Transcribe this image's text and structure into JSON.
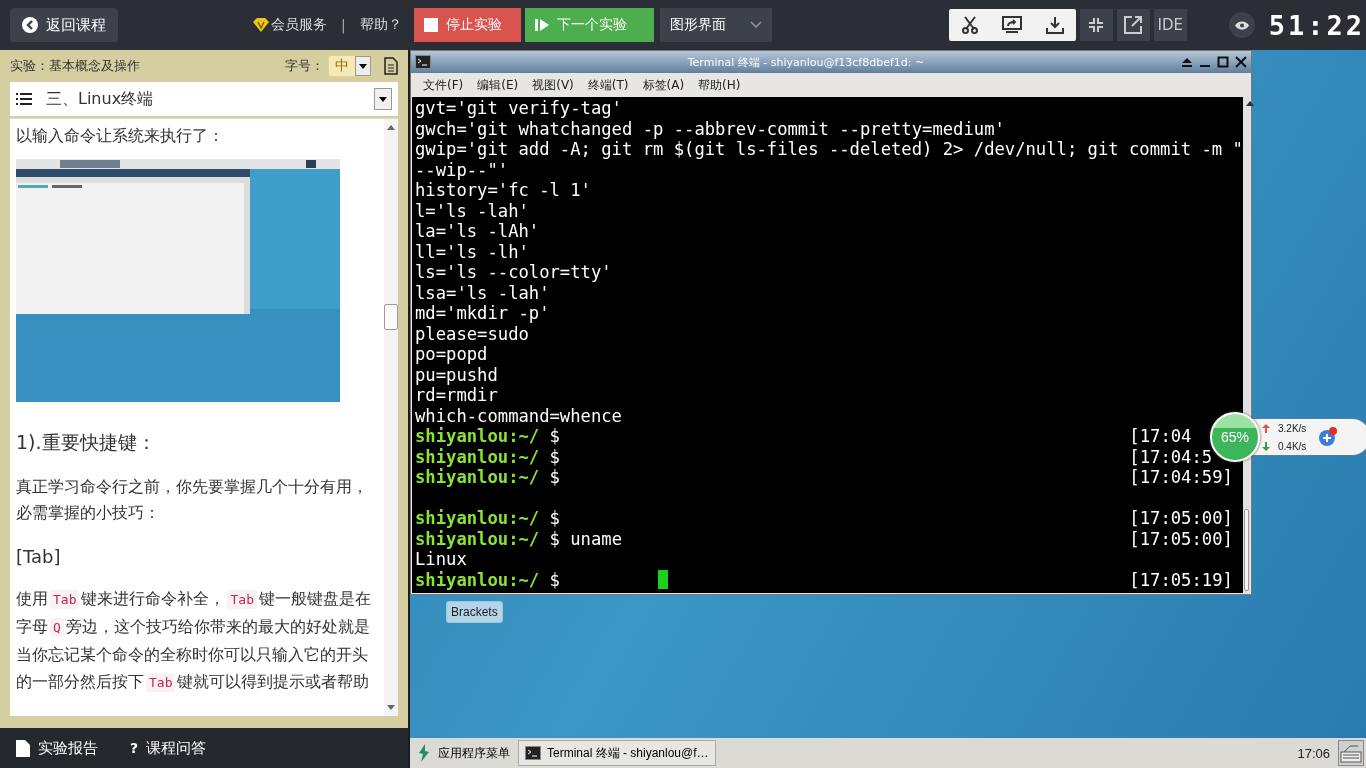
{
  "topbar": {
    "back_button": "返回课程",
    "vip_link": "会员服务",
    "separator": "|",
    "help_link": "帮助？",
    "stop_button": "停止实验",
    "next_button": "下一个实验",
    "mode_dropdown": "图形界面",
    "ide_button": "IDE",
    "timer": "51:22"
  },
  "lab_panel": {
    "lab_title": "实验：基本概念及操作",
    "font_size_label": "字号：",
    "font_size_value": "中",
    "section_select": "三、Linux终端",
    "content": [
      {
        "kind": "paragraph",
        "text": "以输入命令让系统来执行了："
      },
      {
        "kind": "picture"
      },
      {
        "kind": "heading",
        "text": "1).重要快捷键："
      },
      {
        "kind": "paragraph",
        "text": "真正学习命令行之前，你先要掌握几个十分有用，必需掌握的小技巧："
      },
      {
        "kind": "subheading",
        "text": "[Tab]"
      },
      {
        "kind": "code_paragraph",
        "segments": [
          {
            "kind": "text",
            "text": "使用"
          },
          {
            "kind": "code",
            "text": "Tab"
          },
          {
            "kind": "text",
            "text": "键来进行命令补全，"
          },
          {
            "kind": "code",
            "text": "Tab"
          },
          {
            "kind": "text",
            "text": "键一般键盘是在字母"
          },
          {
            "kind": "code",
            "text": "Q"
          },
          {
            "kind": "text",
            "text": "旁边，这个技巧给你带来的最大的好处就是当你忘记某个命令的全称时你可以只输入它的开头的一部分然后按下"
          },
          {
            "kind": "code",
            "text": "Tab"
          },
          {
            "kind": "text",
            "text": "键就可以得到提示或者帮助"
          }
        ]
      }
    ]
  },
  "footer": [
    {
      "kind": "report",
      "label": "实验报告"
    },
    {
      "kind": "qa",
      "icon": "?",
      "label": "课程问答"
    }
  ],
  "terminal": {
    "title": "Terminal 终端 - shiyanlou@f13cf8dbef1d: ~",
    "menu": [
      "文件(F)",
      "编辑(E)",
      "视图(V)",
      "终端(T)",
      "标签(A)",
      "帮助(H)"
    ],
    "lines": [
      {
        "kind": "output",
        "text": "gvt='git verify-tag'"
      },
      {
        "kind": "output",
        "text": "gwch='git whatchanged -p --abbrev-commit --pretty=medium'"
      },
      {
        "kind": "output",
        "text": "gwip='git add -A; git rm $(git ls-files --deleted) 2> /dev/null; git commit -m \""
      },
      {
        "kind": "output",
        "text": "--wip--\"'"
      },
      {
        "kind": "output",
        "text": "history='fc -l 1'"
      },
      {
        "kind": "output",
        "text": "l='ls -lah'"
      },
      {
        "kind": "output",
        "text": "la='ls -lAh'"
      },
      {
        "kind": "output",
        "text": "ll='ls -lh'"
      },
      {
        "kind": "output",
        "text": "ls='ls --color=tty'"
      },
      {
        "kind": "output",
        "text": "lsa='ls -lah'"
      },
      {
        "kind": "output",
        "text": "md='mkdir -p'"
      },
      {
        "kind": "output",
        "text": "please=sudo"
      },
      {
        "kind": "output",
        "text": "po=popd"
      },
      {
        "kind": "output",
        "text": "pu=pushd"
      },
      {
        "kind": "output",
        "text": "rd=rmdir"
      },
      {
        "kind": "output",
        "text": "which-command=whence"
      },
      {
        "kind": "prompt",
        "prompt": "shiyanlou:~/",
        "command": "$",
        "time": "[17:04"
      },
      {
        "kind": "prompt",
        "prompt": "shiyanlou:~/",
        "command": "$",
        "time": "[17:04:5"
      },
      {
        "kind": "prompt",
        "prompt": "shiyanlou:~/",
        "command": "$",
        "time": "[17:04:59]"
      },
      {
        "kind": "blank"
      },
      {
        "kind": "prompt",
        "prompt": "shiyanlou:~/",
        "command": "$",
        "time": "[17:05:00]"
      },
      {
        "kind": "prompt",
        "prompt": "shiyanlou:~/",
        "command": "$ uname",
        "time": "[17:05:00]"
      },
      {
        "kind": "output",
        "text": "Linux"
      },
      {
        "kind": "prompt",
        "prompt": "shiyanlou:~/",
        "command": "$",
        "time": "[17:05:19]",
        "cursor": true
      }
    ]
  },
  "desktop_icons": [
    {
      "label": "Brackets"
    }
  ],
  "speed_widget": {
    "percent": "65%",
    "upload": "3.2K/s",
    "download": "0.4K/s"
  },
  "taskbar": {
    "app_menu": "应用程序菜单",
    "tasks": [
      {
        "label": "Terminal 终端 - shiyanlou@f…"
      }
    ],
    "clock": "17:06"
  }
}
